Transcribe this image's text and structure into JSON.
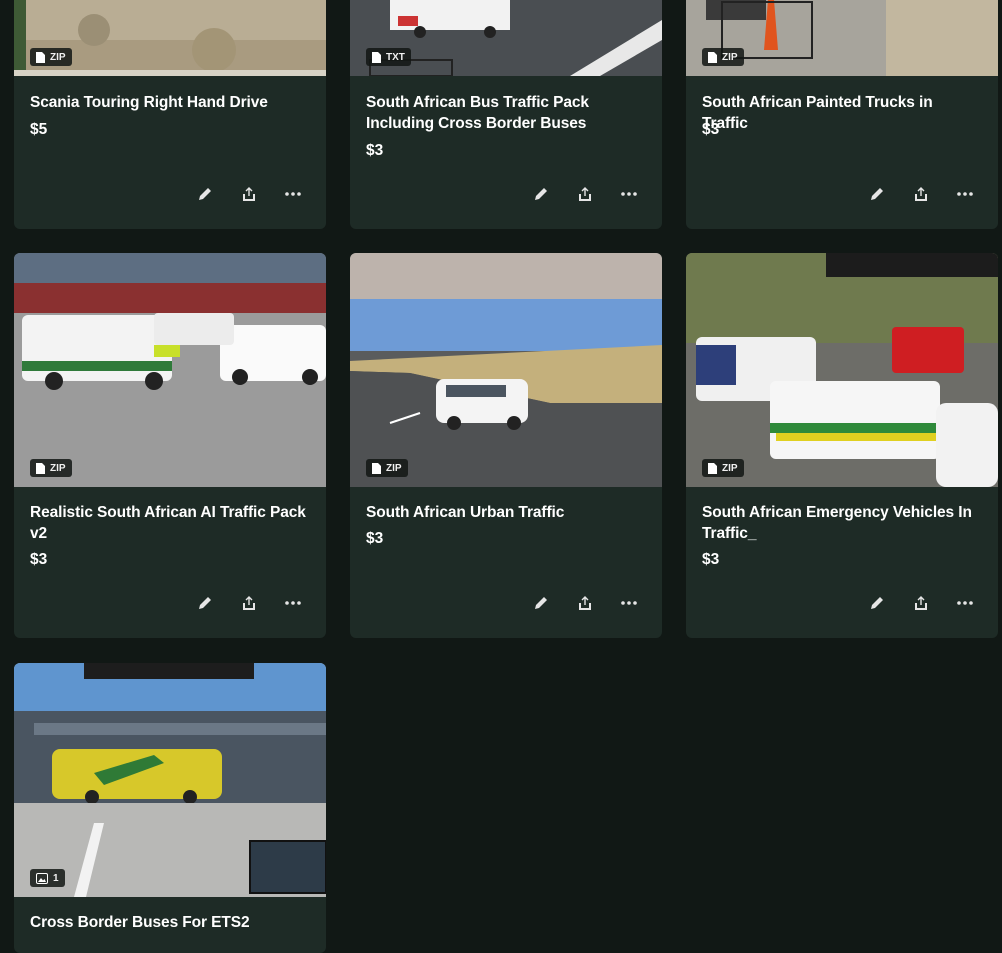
{
  "products": [
    {
      "title": "Scania Touring Right Hand Drive",
      "price": "$5",
      "badge": "ZIP"
    },
    {
      "title": "South African Bus Traffic Pack Including Cross Border Buses",
      "price": "$3",
      "badge": "TXT"
    },
    {
      "title": "South African Painted Trucks in Traffic",
      "price": "$3",
      "badge": "ZIP"
    },
    {
      "title": "Realistic South African AI Traffic Pack v2",
      "price": "$3",
      "badge": "ZIP"
    },
    {
      "title": "South African Urban Traffic",
      "price": "$3",
      "badge": "ZIP"
    },
    {
      "title": "South African Emergency Vehicles In Traffic_",
      "price": "$3",
      "badge": "ZIP"
    },
    {
      "title": "Cross Border Buses For ETS2",
      "price": "",
      "badge": "1"
    }
  ],
  "icons": {
    "edit": "pencil-icon",
    "share": "share-icon",
    "more": "more-icon",
    "file": "file-icon",
    "image": "image-icon"
  },
  "colors": {
    "page_bg": "#111815",
    "card_bg": "#1e2b26",
    "text": "#ffffff"
  }
}
